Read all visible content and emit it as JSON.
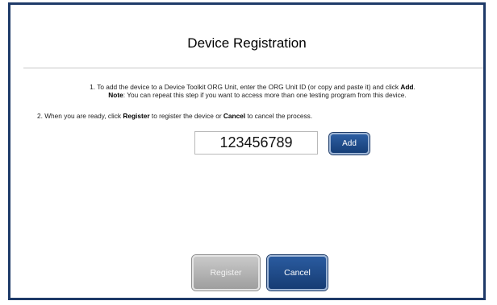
{
  "dialog": {
    "title": "Device Registration"
  },
  "instructions": {
    "step1_pre": "1. To add the device to a Device Toolkit ORG Unit, enter the ORG Unit ID (or copy and paste it) and click ",
    "step1_bold": "Add",
    "step1_post": ".",
    "note_label": "Note",
    "note_text": ": You can repeat this step if you want to access more than one testing program from this device.",
    "step2_pre": "2. When you are ready, click ",
    "step2_register": "Register",
    "step2_mid": " to register the device or ",
    "step2_cancel": "Cancel",
    "step2_post": " to cancel the process."
  },
  "org_unit_input": {
    "value": "123456789"
  },
  "buttons": {
    "add": "Add",
    "register": "Register",
    "cancel": "Cancel"
  },
  "colors": {
    "frame_border": "#1e3a68",
    "primary_button": "#1f4c8c",
    "disabled_button": "#b0b0b0"
  }
}
